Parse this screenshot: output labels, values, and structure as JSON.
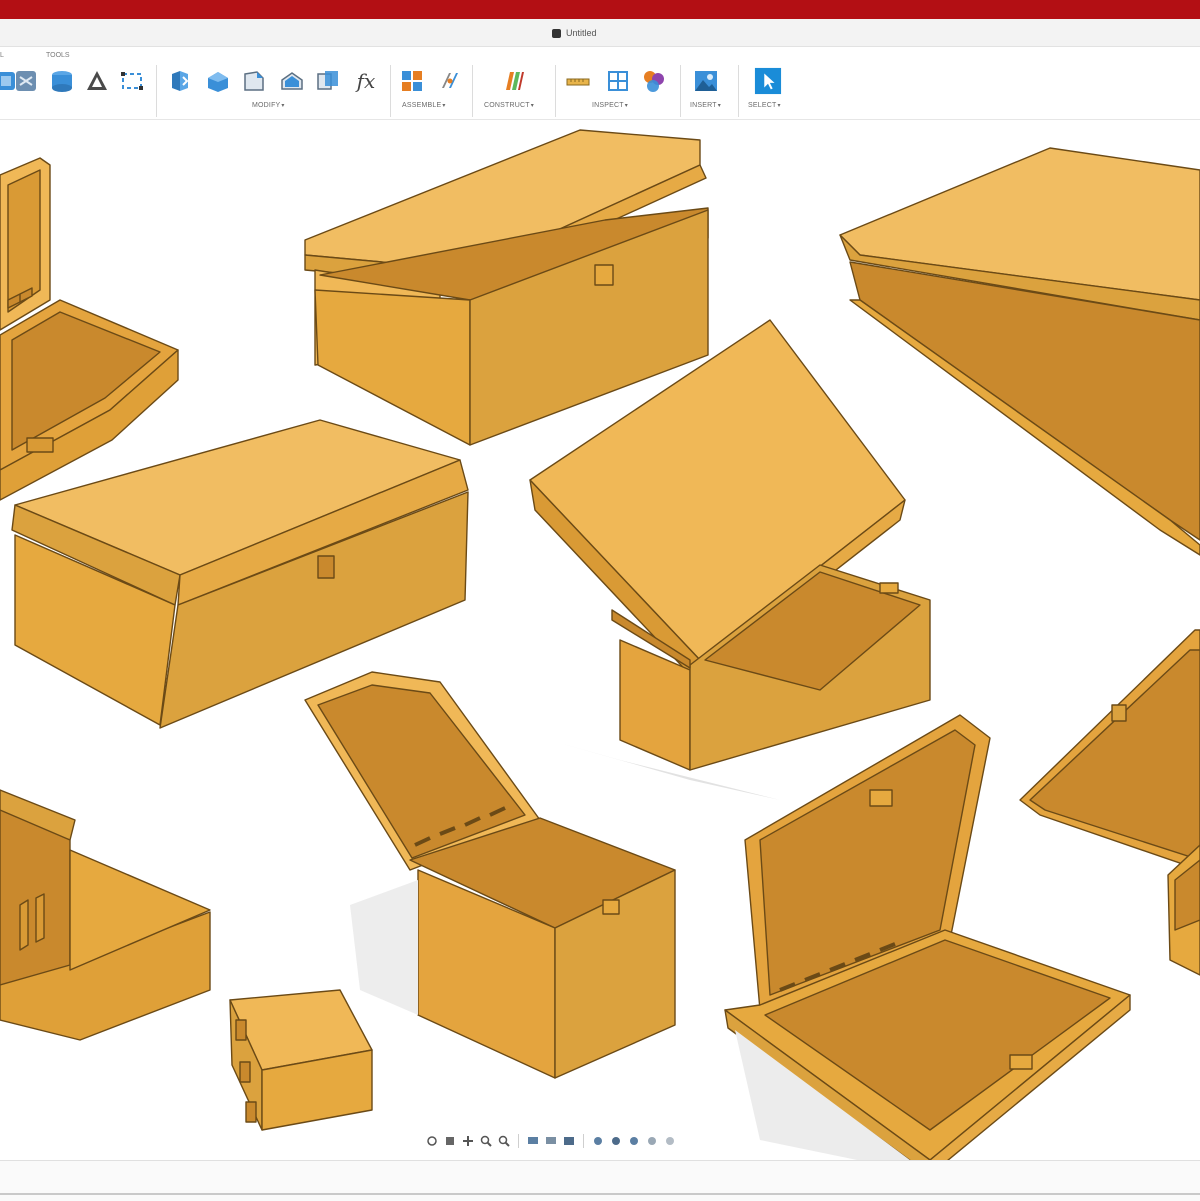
{
  "window": {
    "title_color": "#b30f14",
    "document_tab": {
      "title": "Untitled",
      "icon": "document-icon"
    }
  },
  "toolbar": {
    "captions": {
      "tools": "TOOLS",
      "left_fragment": "L"
    },
    "groups": [
      {
        "id": "modify",
        "label": "MODIFY"
      },
      {
        "id": "assemble",
        "label": "ASSEMBLE"
      },
      {
        "id": "construct",
        "label": "CONSTRUCT"
      },
      {
        "id": "inspect",
        "label": "INSPECT"
      },
      {
        "id": "insert",
        "label": "INSERT"
      },
      {
        "id": "select",
        "label": "SELECT"
      }
    ],
    "caret": "▾",
    "function_icon_label": "fx",
    "icons": [
      "create-box-icon",
      "sketch-view-icon",
      "cylinder-icon",
      "triangle-icon",
      "offset-box-icon",
      "press-pull-icon",
      "fillet-icon",
      "chamfer-icon",
      "shell-icon",
      "combine-icon",
      "parameters-icon",
      "new-component-icon",
      "joint-icon",
      "offset-plane-icon",
      "measure-icon",
      "section-analysis-icon",
      "display-component-colors-icon",
      "insert-image-icon",
      "select-icon"
    ]
  },
  "model": {
    "accent": "#e6a93f",
    "face_dark": "#c9892d",
    "face_light": "#f3be63",
    "outline": "#6b4a16",
    "boxes": [
      "open-box-far-left",
      "hinged-box-top-center",
      "large-lid-top-right",
      "closed-chest-left",
      "tilted-lid-box-center",
      "open-box-right-edge",
      "flip-top-box-bottom-left",
      "tall-open-box-bottom-center",
      "small-box-bottom",
      "open-tray-box-bottom-right"
    ]
  },
  "viewcontrols": [
    "orbit-icon",
    "look-at-icon",
    "pan-icon",
    "zoom-window-icon",
    "zoom-icon",
    "display-settings-icon",
    "grid-snap-icon",
    "viewports-icon",
    "visual-style-1-icon",
    "visual-style-2-icon",
    "visual-style-3-icon",
    "visual-style-4-icon",
    "visual-style-5-icon"
  ]
}
